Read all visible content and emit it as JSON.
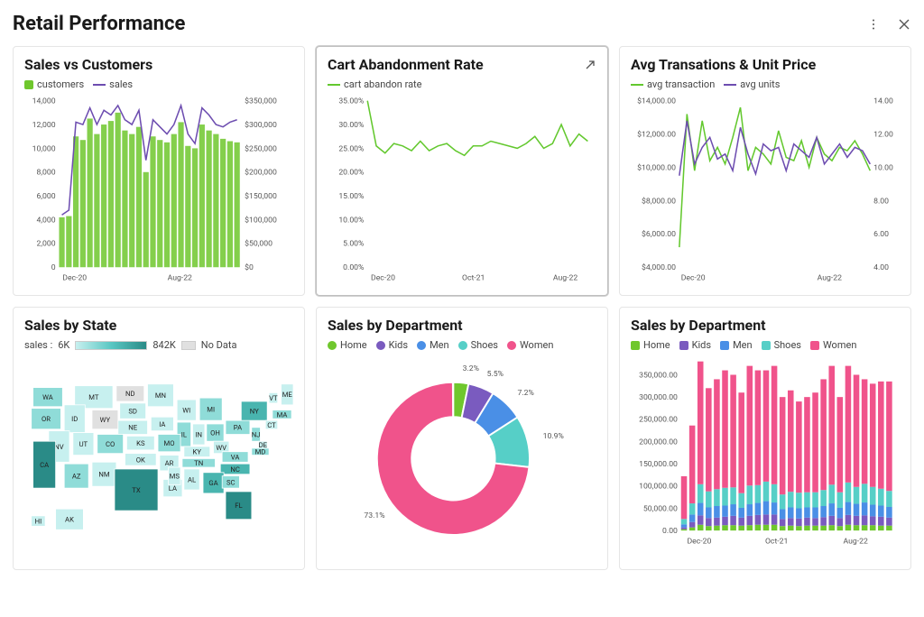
{
  "header": {
    "title": "Retail Performance"
  },
  "cards": {
    "sales_customers": {
      "title": "Sales vs Customers",
      "legend": {
        "customers": "customers",
        "sales": "sales"
      },
      "xaxis": {
        "start": "Dec-20",
        "end": "Aug-22"
      }
    },
    "cart_abandon": {
      "title": "Cart Abandonment Rate",
      "legend": {
        "rate": "cart abandon rate"
      },
      "xaxis": {
        "start": "Dec-20",
        "mid": "Oct-21",
        "end": "Aug-22"
      }
    },
    "avg_trans": {
      "title": "Avg Transations & Unit Price",
      "legend": {
        "trans": "avg transaction",
        "units": "avg units"
      },
      "xaxis": {
        "start": "Dec-20",
        "end": "Aug-22"
      }
    },
    "sales_state": {
      "title": "Sales by State",
      "legend_label": "sales :",
      "min": "6K",
      "max": "842K",
      "nodata": "No Data"
    },
    "sales_dept_pie": {
      "title": "Sales by Department",
      "legend": {
        "home": "Home",
        "kids": "Kids",
        "men": "Men",
        "shoes": "Shoes",
        "women": "Women"
      }
    },
    "sales_dept_bar": {
      "title": "Sales by Department",
      "legend": {
        "home": "Home",
        "kids": "Kids",
        "men": "Men",
        "shoes": "Shoes",
        "women": "Women"
      },
      "xaxis": {
        "start": "Dec-20",
        "mid": "Oct-21",
        "end": "Aug-22"
      }
    }
  },
  "colors": {
    "green": "#6fc72d",
    "purple": "#6d4db0",
    "limegreen": "#63c82e",
    "pie_home": "#6fc72d",
    "pie_kids": "#7a5bbf",
    "pie_men": "#4a8fe6",
    "pie_shoes": "#56cfc7",
    "pie_women": "#f0538b"
  },
  "chart_data": [
    {
      "id": "sales_vs_customers",
      "type": "bar+line",
      "x_range": [
        "Dec-20",
        "Aug-22"
      ],
      "y_left": {
        "label": "customers",
        "ticks": [
          0,
          2000,
          4000,
          6000,
          8000,
          10000,
          12000,
          14000
        ]
      },
      "y_right": {
        "label": "sales ($)",
        "ticks": [
          0,
          50000,
          100000,
          150000,
          200000,
          250000,
          300000,
          350000
        ]
      },
      "bars_customers": [
        4200,
        4300,
        11000,
        10700,
        12500,
        11200,
        12000,
        12300,
        13000,
        11500,
        11200,
        11800,
        8000,
        11000,
        10700,
        10500,
        11200,
        12200,
        10200,
        10000,
        12000,
        11500,
        11200,
        10800,
        10600,
        10500
      ],
      "line_sales": [
        110000,
        120000,
        305000,
        300000,
        335000,
        300000,
        330000,
        320000,
        340000,
        310000,
        300000,
        330000,
        225000,
        310000,
        295000,
        280000,
        300000,
        340000,
        280000,
        260000,
        335000,
        320000,
        300000,
        295000,
        305000,
        310000
      ]
    },
    {
      "id": "cart_abandonment",
      "type": "line",
      "x_range": [
        "Dec-20",
        "Oct-21",
        "Aug-22"
      ],
      "y": {
        "label": "rate (%)",
        "ticks": [
          0,
          5,
          10,
          15,
          20,
          25,
          30,
          35
        ]
      },
      "values_pct": [
        35.0,
        25.5,
        24.0,
        26.0,
        25.5,
        24.5,
        26.5,
        24.5,
        25.5,
        26.0,
        24.5,
        23.5,
        25.5,
        25.5,
        26.5,
        26.0,
        25.5,
        25.0,
        26.0,
        27.5,
        25.0,
        26.0,
        30.0,
        25.5,
        28.0,
        26.5
      ]
    },
    {
      "id": "avg_transactions_units",
      "type": "line",
      "x_range": [
        "Dec-20",
        "Aug-22"
      ],
      "y_left": {
        "label": "avg transaction ($)",
        "ticks": [
          4000,
          6000,
          8000,
          10000,
          12000,
          14000
        ]
      },
      "y_right": {
        "label": "avg units",
        "ticks": [
          4,
          6,
          8,
          10,
          12,
          14
        ]
      },
      "series": [
        {
          "name": "avg transaction",
          "values": [
            5200,
            13200,
            9800,
            12800,
            10400,
            11200,
            10200,
            11800,
            13600,
            9800,
            11200,
            10800,
            10200,
            12200,
            10600,
            10400,
            11600,
            10000,
            11800,
            10800,
            10400,
            11200,
            11000,
            11600,
            10800,
            9800
          ]
        },
        {
          "name": "avg units",
          "values": [
            9.5,
            12.8,
            10.2,
            11.2,
            11.8,
            10.5,
            10.8,
            9.8,
            12.4,
            10.8,
            9.6,
            11.4,
            11.0,
            11.2,
            9.8,
            11.4,
            11.0,
            10.6,
            11.8,
            10.2,
            10.8,
            11.4,
            10.6,
            11.2,
            11.0,
            10.2
          ]
        }
      ]
    },
    {
      "id": "sales_by_state",
      "type": "map",
      "note": "US choropleth; color intensity = sales. Range shown 6K–842K. States ND and WY render as No Data (grey). CA, TX, FL, NY darkest (highest sales)."
    },
    {
      "id": "sales_by_department_pie",
      "type": "pie",
      "slices": [
        {
          "name": "Home",
          "pct": 3.2
        },
        {
          "name": "Kids",
          "pct": 5.5
        },
        {
          "name": "Men",
          "pct": 7.2
        },
        {
          "name": "Shoes",
          "pct": 10.9
        },
        {
          "name": "Women",
          "pct": 73.1
        }
      ]
    },
    {
      "id": "sales_by_department_bar",
      "type": "bar",
      "stacked": true,
      "x_range": [
        "Dec-20",
        "Oct-21",
        "Aug-22"
      ],
      "y": {
        "ticks": [
          0,
          50000,
          100000,
          150000,
          200000,
          250000,
          300000,
          350000
        ]
      },
      "categories": [
        "Home",
        "Kids",
        "Men",
        "Shoes",
        "Women"
      ],
      "stacks": [
        [
          3000,
          4000,
          7000,
          12000,
          96000
        ],
        [
          7000,
          12000,
          17000,
          25000,
          175000
        ],
        [
          13000,
          21000,
          28000,
          42000,
          276000
        ],
        [
          10000,
          18000,
          24000,
          36000,
          232000
        ],
        [
          11000,
          18000,
          26000,
          38000,
          247000
        ],
        [
          12000,
          19000,
          25000,
          40000,
          264000
        ],
        [
          12000,
          21000,
          26000,
          38000,
          253000
        ],
        [
          11000,
          18000,
          22000,
          33000,
          226000
        ],
        [
          12000,
          21000,
          26000,
          42000,
          269000
        ],
        [
          13000,
          22000,
          27000,
          40000,
          258000
        ],
        [
          13000,
          23000,
          30000,
          44000,
          250000
        ],
        [
          13000,
          23000,
          27000,
          41000,
          266000
        ],
        [
          10000,
          16000,
          22000,
          33000,
          219000
        ],
        [
          11000,
          17000,
          24000,
          35000,
          228000
        ],
        [
          10000,
          17000,
          23000,
          35000,
          205000
        ],
        [
          11000,
          18000,
          23000,
          34000,
          214000
        ],
        [
          11000,
          17000,
          24000,
          34000,
          224000
        ],
        [
          11000,
          19000,
          25000,
          36000,
          249000
        ],
        [
          12000,
          21000,
          28000,
          42000,
          267000
        ],
        [
          10000,
          18000,
          23000,
          35000,
          214000
        ],
        [
          13000,
          22000,
          29000,
          44000,
          262000
        ],
        [
          12000,
          21000,
          27000,
          38000,
          252000
        ],
        [
          12000,
          22000,
          29000,
          42000,
          235000
        ],
        [
          12000,
          20000,
          26000,
          40000,
          232000
        ],
        [
          11000,
          20000,
          25000,
          38000,
          241000
        ],
        [
          11000,
          18000,
          24000,
          36000,
          246000
        ]
      ]
    }
  ]
}
